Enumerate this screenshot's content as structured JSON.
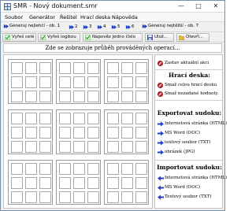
{
  "window": {
    "title": "SMR - Nový dokument.smr",
    "controls": {
      "minimize": "—",
      "maximize": "□",
      "close": "✕"
    }
  },
  "menu": [
    "Soubor",
    "Generátor",
    "Řešitel",
    "Hrací deska",
    "Nápověda"
  ],
  "toolbar1": {
    "generate_easiest": "Generuj nejlehčí - ob. 1",
    "levels": [
      "2",
      "3",
      "4",
      "5",
      "6"
    ],
    "generate_hardest": "Generuj nejtěžší - ob. 7"
  },
  "toolbar2": {
    "solve_all": "Vyřeš celé",
    "solve_logic": "Vyřeš logikou",
    "hint_one": "Napověz jedno číslo",
    "save": "Ulož...",
    "open": "Otevři..."
  },
  "progress_text": "Zde se zobrazuje průběh prováděných operací...",
  "side": {
    "stop_action": "Zastav aktuální akci",
    "board_title": "Hrací deska:",
    "board_actions": [
      "Smaž celou hrací desku",
      "Smaž nezadané hodnoty"
    ],
    "export_title": "Exportovat sudoku:",
    "export_items": [
      "Internetová stránka (HTML)",
      "MS Word (DOC)",
      "textový soubor (TXT)",
      "obrázek (JPG)"
    ],
    "import_title": "Importovat sudoku:",
    "import_items": [
      "Internetová stránka (HTML)",
      "MS Word (DOC)",
      "Textový soubor (TXT)"
    ]
  },
  "colors": {
    "arrow_blue": "#1f3fc4",
    "stop_red": "#d8262e",
    "check_green": "#2e9a2e"
  },
  "icons": {
    "generate": "blue-arrow-icon",
    "solve": "green-check-icon",
    "hint": "green-check-icon",
    "save": "floppy-icon",
    "open": "folder-icon",
    "stop": "red-stop-icon",
    "export": "export-arrow-icon",
    "import": "import-arrow-icon"
  }
}
